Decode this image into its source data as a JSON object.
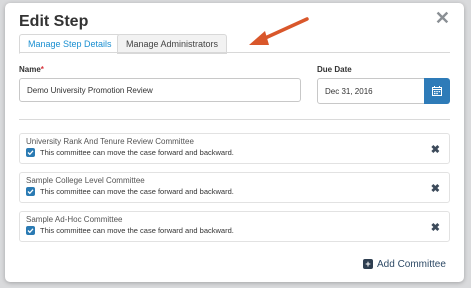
{
  "dialog": {
    "title": "Edit Step",
    "close_icon": "close-icon"
  },
  "tabs": [
    {
      "label": "Manage Step Details",
      "active": true
    },
    {
      "label": "Manage Administrators",
      "active": false
    }
  ],
  "form": {
    "name_label": "Name",
    "name_required_marker": "*",
    "name_value": "Demo University Promotion Review",
    "due_date_label": "Due Date",
    "due_date_value": "Dec 31, 2016",
    "calendar_icon": "calendar-icon"
  },
  "committees": [
    {
      "name": "University Rank And Tenure Review Committee",
      "note": "This committee can move the case forward and backward.",
      "checked": true
    },
    {
      "name": "Sample College Level Committee",
      "note": "This committee can move the case forward and backward.",
      "checked": true
    },
    {
      "name": "Sample Ad-Hoc Committee",
      "note": "This committee can move the case forward and backward.",
      "checked": true
    }
  ],
  "actions": {
    "add_committee_label": "Add Committee",
    "add_icon": "plus-square-icon"
  },
  "colors": {
    "accent": "#1a8fd1",
    "button_blue": "#2e7bb8",
    "arrow": "#d9572b"
  }
}
